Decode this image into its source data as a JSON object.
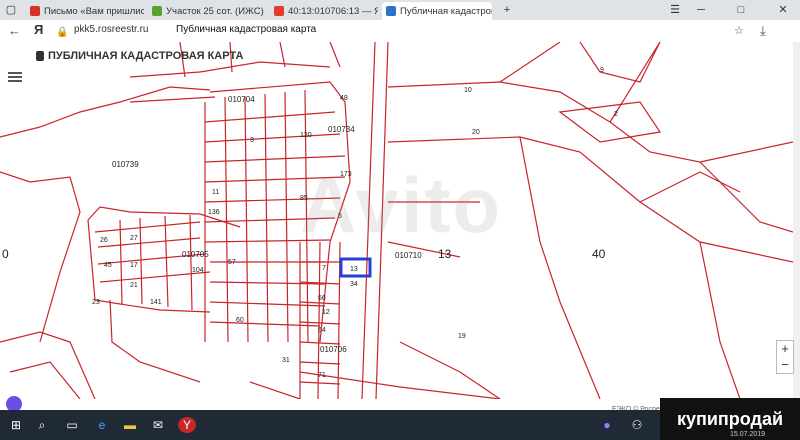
{
  "browser": {
    "tabs": [
      {
        "label": "Письмо «Вам пришлис нов",
        "icon": "gmail-icon",
        "color": "#d93025"
      },
      {
        "label": "Участок 25 сот. (ИЖС) — Р",
        "icon": "avito-icon",
        "color": "#5aa02c"
      },
      {
        "label": "40:13:010706:13 — Яндекс",
        "icon": "yandex-icon",
        "color": "#e63b2e"
      },
      {
        "label": "Публичная кадастровая",
        "icon": "rosreestr-icon",
        "color": "#2a73c9",
        "active": true
      }
    ],
    "new_tab": "+",
    "url": "pkk5.rosreestr.ru",
    "page_title": "Публичная кадастровая карта",
    "brand": "Я"
  },
  "map": {
    "title": "ПУБЛИЧНАЯ КАДАСТРОВАЯ КАРТА",
    "watermark": "Avito",
    "zoom_in": "+",
    "zoom_out": "−",
    "attribution": "ЕЭКО © Росреес",
    "line_color": "#c9242b",
    "highlight_color": "#2b3fd1",
    "labels": [
      {
        "t": "010704"
      },
      {
        "t": "010734"
      },
      {
        "t": "010739"
      },
      {
        "t": "010705"
      },
      {
        "t": "010706"
      },
      {
        "t": "010710"
      },
      {
        "t": "13"
      },
      {
        "t": "40"
      },
      {
        "t": "0"
      },
      {
        "t": "10"
      },
      {
        "t": "20"
      },
      {
        "t": "19"
      },
      {
        "t": "9"
      },
      {
        "t": "2"
      },
      {
        "t": "34"
      },
      {
        "t": "11"
      },
      {
        "t": "136"
      },
      {
        "t": "27"
      },
      {
        "t": "26"
      },
      {
        "t": "45"
      },
      {
        "t": "17"
      },
      {
        "t": "21"
      },
      {
        "t": "104"
      },
      {
        "t": "7"
      },
      {
        "t": "141"
      },
      {
        "t": "60"
      },
      {
        "t": "23"
      },
      {
        "t": "57"
      },
      {
        "t": "66"
      },
      {
        "t": "71"
      },
      {
        "t": "12"
      },
      {
        "t": "85"
      },
      {
        "t": "3"
      },
      {
        "t": "5"
      },
      {
        "t": "48"
      },
      {
        "t": "31"
      },
      {
        "t": "173"
      },
      {
        "t": "120"
      },
      {
        "t": "64"
      }
    ],
    "selected_parcel": "13"
  },
  "taskbar": {
    "clock": "15.07.2019"
  },
  "promo": {
    "text": "купипродай"
  }
}
